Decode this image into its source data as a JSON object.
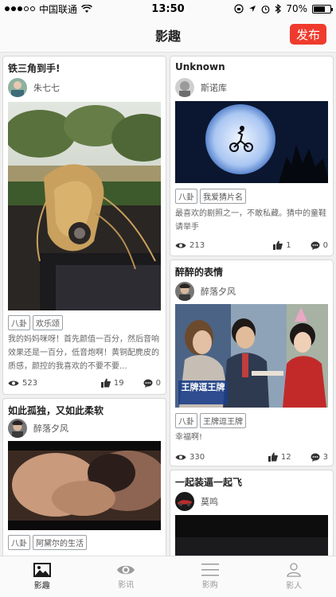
{
  "status_bar": {
    "carrier": "中国联通",
    "time": "13:50",
    "battery": "70%"
  },
  "nav": {
    "title": "影趣",
    "publish_label": "发布"
  },
  "cards": [
    {
      "title": "铁三角到手!",
      "author": "朱七七",
      "tags": [
        "八卦",
        "欢乐颂"
      ],
      "description": "我的妈妈咪呀！首先颜值一百分，然后音响效果还是一百分，低音炮啊！黄铜配麂皮的质感，颜控的我喜欢的不要不要...",
      "views": "523",
      "likes": "19",
      "comments": "0",
      "image": "desk-earphones-photo"
    },
    {
      "title": "Unknown",
      "author": "斯诺库",
      "tags": [
        "八卦",
        "我爱猜片名"
      ],
      "description": "最喜欢的剧照之一，不敢私藏。猜中的童鞋请举手",
      "views": "213",
      "likes": "1",
      "comments": "0",
      "image": "moon-bicycle-photo"
    },
    {
      "title": "醉醉的表情",
      "author": "醉落夕风",
      "tags": [
        "八卦",
        "王牌逗王牌"
      ],
      "description": "幸福啊!",
      "views": "330",
      "likes": "12",
      "comments": "3",
      "image": "movie-still-photo",
      "image_caption": "王牌逗王牌"
    },
    {
      "title": "如此孤独，又如此柔软",
      "author": "醉落夕风",
      "tags": [
        "八卦",
        "阿黛尔的生活"
      ],
      "image": "film-still-photo"
    },
    {
      "title": "一起装逼一起飞",
      "author": "莫鸣",
      "image": "dark-photo"
    }
  ],
  "tabs": [
    {
      "label": "影趣",
      "icon": "image-icon",
      "active": true
    },
    {
      "label": "影讯",
      "icon": "eye-icon",
      "active": false
    },
    {
      "label": "影购",
      "icon": "menu-lines-icon",
      "active": false
    },
    {
      "label": "影人",
      "icon": "person-icon",
      "active": false
    }
  ],
  "colors": {
    "accent": "#ef3b2d",
    "background": "#f0f0f0",
    "active_tab": "#222222",
    "inactive_tab": "#999999"
  }
}
